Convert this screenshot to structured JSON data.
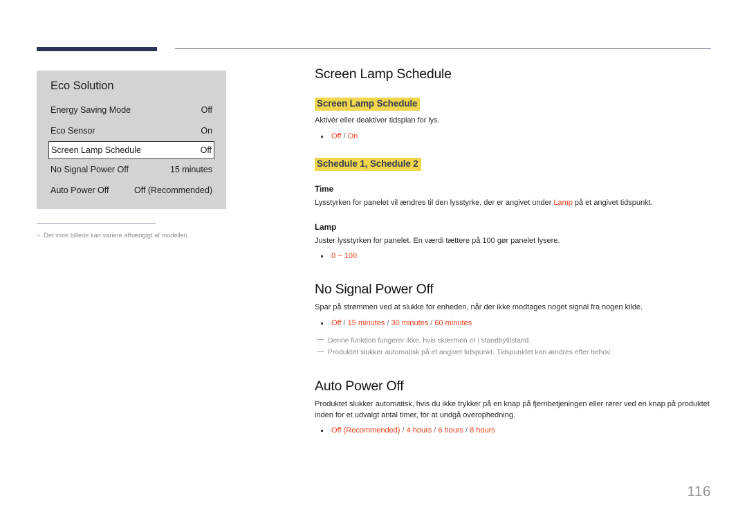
{
  "header": {
    "rule_color": "#2c3355",
    "thin_rule_color": "#5b6078"
  },
  "osd": {
    "title": "Eco Solution",
    "rows": [
      {
        "label": "Energy Saving Mode",
        "value": "Off",
        "selected": false
      },
      {
        "label": "Eco Sensor",
        "value": "On",
        "selected": false
      },
      {
        "label": "Screen Lamp Schedule",
        "value": "Off",
        "selected": true
      },
      {
        "label": "No Signal Power Off",
        "value": "15 minutes",
        "selected": false
      },
      {
        "label": "Auto Power Off",
        "value": "Off (Recommended)",
        "selected": false
      }
    ]
  },
  "footnote": {
    "dash": "–",
    "text": "Det viste billede kan variere afhængigt af modellen."
  },
  "content": {
    "title_1": "Screen Lamp Schedule",
    "highlight_1": "Screen Lamp Schedule",
    "desc_1": "Aktivér eller deaktiver tidsplan for lys.",
    "options_1": {
      "a": "Off",
      "sep1": " / ",
      "b": "On"
    },
    "highlight_2": "Schedule 1, Schedule 2",
    "sub_time": "Time",
    "desc_time_pre": "Lysstyrken for panelet vil ændres til den lysstyrke, der er angivet under ",
    "desc_time_accent": "Lamp",
    "desc_time_post": " på et angivet tidspunkt.",
    "sub_lamp": "Lamp",
    "desc_lamp": "Juster lysstyrken for panelet. En værdi tættere på 100 gør panelet lysere.",
    "options_lamp": "0 ~ 100",
    "title_2": "No Signal Power Off",
    "desc_2": "Spar på strømmen ved at slukke for enheden, når der ikke modtages noget signal fra nogen kilde.",
    "options_2": {
      "a": "Off",
      "sep1": " / ",
      "b": "15 minutes",
      "sep2": " / ",
      "c": "30 minutes",
      "sep3": " / ",
      "d": "60 minutes"
    },
    "note_1": "Denne funktion fungerer ikke, hvis skærmen er i standbytilstand.",
    "note_2": "Produktet slukker automatisk på et angivet tidspunkt. Tidspunktet kan ændres efter behov.",
    "title_3": "Auto Power Off",
    "desc_3": "Produktet slukker automatisk, hvis du ikke trykker på en knap på fjernbetjeningen eller rører ved en knap på produktet inden for et udvalgt antal timer, for at undgå overophedning.",
    "options_3": {
      "a": "Off (Recommended)",
      "sep1": " / ",
      "b": "4 hours",
      "sep2": " / ",
      "c": "6 hours",
      "sep3": " / ",
      "d": "8 hours"
    }
  },
  "page_number": "116",
  "colors": {
    "accent_red": "#e8411f",
    "highlight_yellow": "#f0d64c",
    "navy": "#2c3355",
    "osd_bg": "#d3d3d3"
  }
}
